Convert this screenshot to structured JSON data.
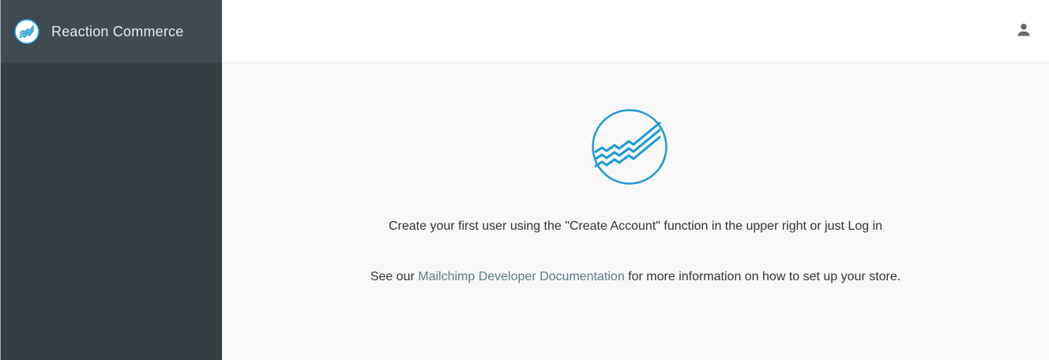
{
  "sidebar": {
    "brand_title": "Reaction Commerce",
    "brand_icon": "reaction-logo-icon"
  },
  "topbar": {
    "account_icon": "person-icon"
  },
  "main": {
    "logo_icon": "reaction-logo-icon",
    "intro_text": "Create your first user using the \"Create Account\" function in the upper right or just Log in",
    "docs_prefix": "See our",
    "docs_link_label": "Mailchimp Developer Documentation",
    "docs_suffix": "for more information on how to set up your store."
  },
  "colors": {
    "sidebar_bg": "#353e43",
    "sidebar_header_bg": "#3f4a51",
    "accent": "#1e9ad6",
    "link": "#5a7a8a"
  }
}
